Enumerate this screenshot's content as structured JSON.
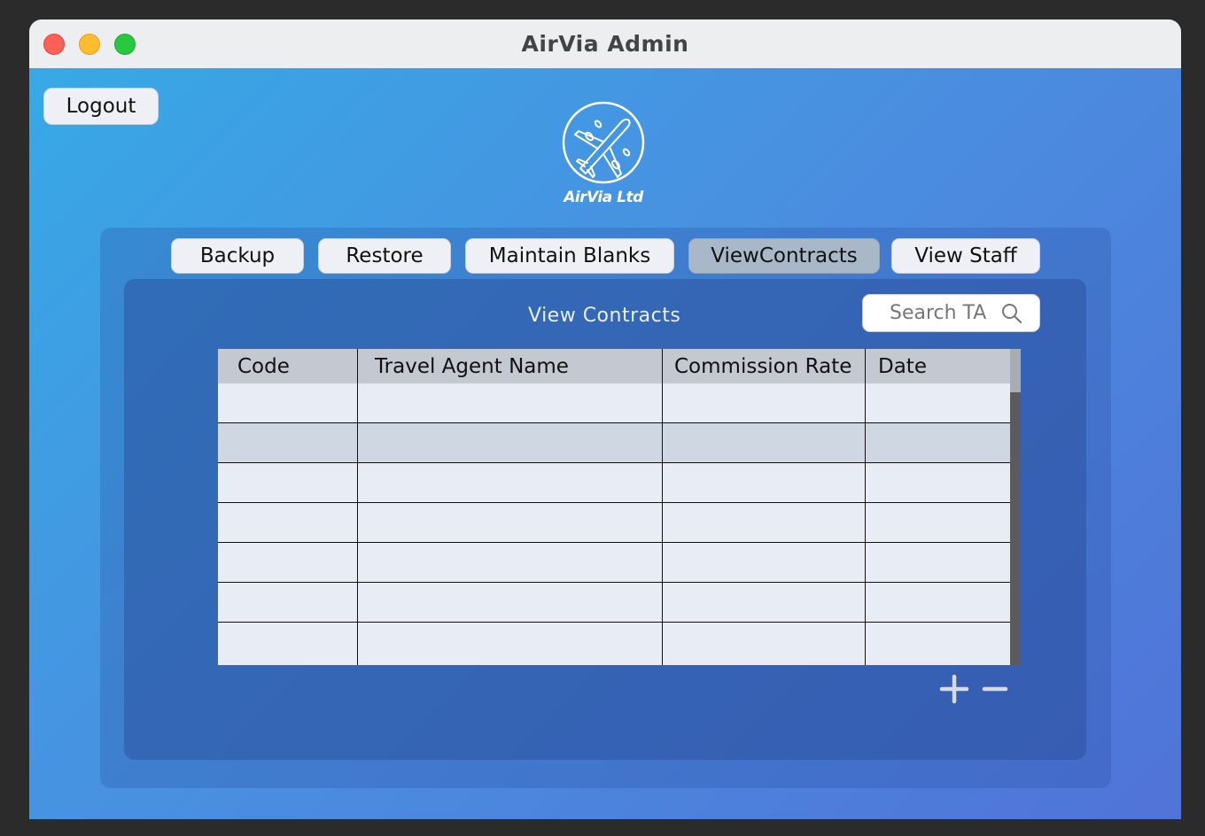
{
  "window": {
    "title": "AirVia Admin"
  },
  "header": {
    "logout_label": "Logout",
    "logo_text": "AirVia Ltd",
    "logo_icon": "airplane-icon"
  },
  "nav": {
    "items": [
      {
        "label": "Backup",
        "active": false
      },
      {
        "label": "Restore",
        "active": false
      },
      {
        "label": "Maintain Blanks",
        "active": false
      },
      {
        "label": "ViewContracts",
        "active": true
      },
      {
        "label": "View Staff",
        "active": false
      }
    ]
  },
  "main": {
    "title": "View Contracts",
    "search": {
      "placeholder": "Search TA",
      "icon": "search-icon"
    },
    "table": {
      "columns": [
        "Code",
        "Travel Agent Name",
        "Commission Rate",
        "Date"
      ],
      "rows": [
        [
          "",
          "",
          "",
          ""
        ],
        [
          "",
          "",
          "",
          ""
        ],
        [
          "",
          "",
          "",
          ""
        ],
        [
          "",
          "",
          "",
          ""
        ],
        [
          "",
          "",
          "",
          ""
        ],
        [
          "",
          "",
          "",
          ""
        ],
        [
          "",
          "",
          "",
          ""
        ]
      ],
      "selected_row": 1
    },
    "actions": {
      "add_icon": "plus-icon",
      "remove_icon": "minus-icon"
    }
  },
  "colors": {
    "background_gradient_start": "#36aae6",
    "background_gradient_end": "#5073d8",
    "button_bg": "#eef0f5",
    "active_button_bg": "#a9b8c9",
    "table_header_bg": "#c3c8d1",
    "table_row_bg": "#e8edf5",
    "selected_row_bg": "#cfd7e2"
  }
}
